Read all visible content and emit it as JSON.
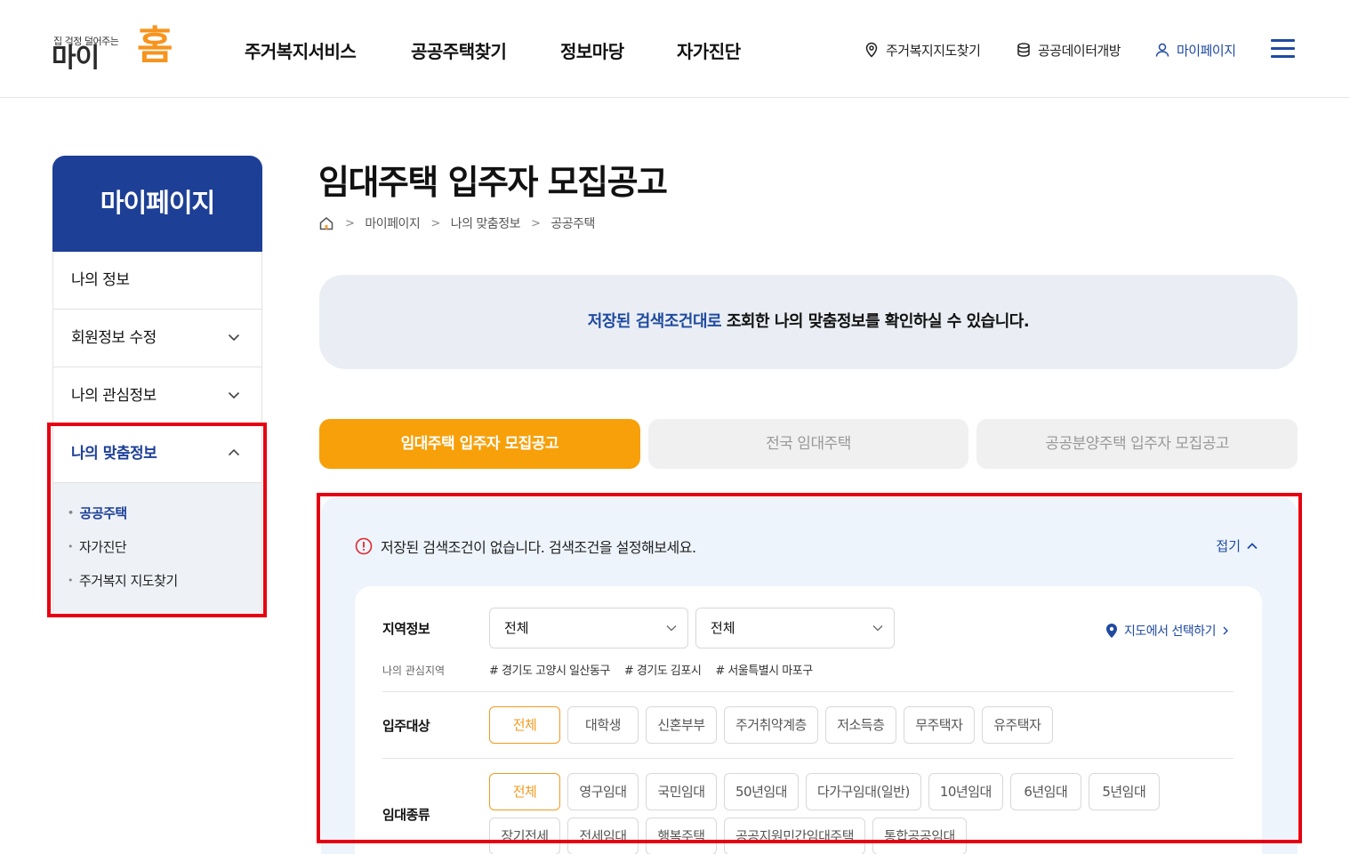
{
  "header": {
    "logo": {
      "tagline": "집 걱정 덜어주는",
      "name_main": "마이",
      "name_accent": "홈"
    },
    "nav": [
      "주거복지서비스",
      "공공주택찾기",
      "정보마당",
      "자가진단"
    ],
    "util": {
      "map": "주거복지지도찾기",
      "opendata": "공공데이터개방",
      "mypage": "마이페이지"
    }
  },
  "sidebar": {
    "title": "마이페이지",
    "items": [
      {
        "label": "나의 정보"
      },
      {
        "label": "회원정보 수정"
      },
      {
        "label": "나의 관심정보"
      },
      {
        "label": "나의 맞춤정보"
      }
    ],
    "submenu": [
      "공공주택",
      "자가진단",
      "주거복지 지도찾기"
    ]
  },
  "page": {
    "title": "임대주택 입주자 모집공고",
    "breadcrumb": [
      "마이페이지",
      "나의 맞춤정보",
      "공공주택"
    ],
    "notice_highlight": "저장된 검색조건대로",
    "notice_rest": " 조회한 나의 맞춤정보를 확인하실 수 있습니다.",
    "tabs": [
      "임대주택 입주자 모집공고",
      "전국 임대주택",
      "공공분양주택 입주자 모집공고"
    ]
  },
  "filter": {
    "warning": "저장된 검색조건이 없습니다. 검색조건을 설정해보세요.",
    "fold": "접기",
    "region_label": "지역정보",
    "region_select1": "전체",
    "region_select2": "전체",
    "map_select": "지도에서 선택하기",
    "interest_label": "나의 관심지역",
    "interests": [
      "# 경기도 고양시 일산동구",
      "# 경기도 김포시",
      "# 서울특별시 마포구"
    ],
    "target_label": "입주대상",
    "targets": [
      "전체",
      "대학생",
      "신혼부부",
      "주거취약계층",
      "저소득층",
      "무주택자",
      "유주택자"
    ],
    "rent_label": "임대종류",
    "rents": [
      "전체",
      "영구임대",
      "국민임대",
      "50년임대",
      "다가구임대(일반)",
      "10년임대",
      "6년임대",
      "5년임대",
      "장기전세",
      "전세임대",
      "행복주택",
      "공공지원민간임대주택",
      "통합공공임대"
    ]
  },
  "colors": {
    "brand_blue": "#1d3f96",
    "accent_orange": "#f7a00a",
    "highlight_red": "#e60012"
  }
}
